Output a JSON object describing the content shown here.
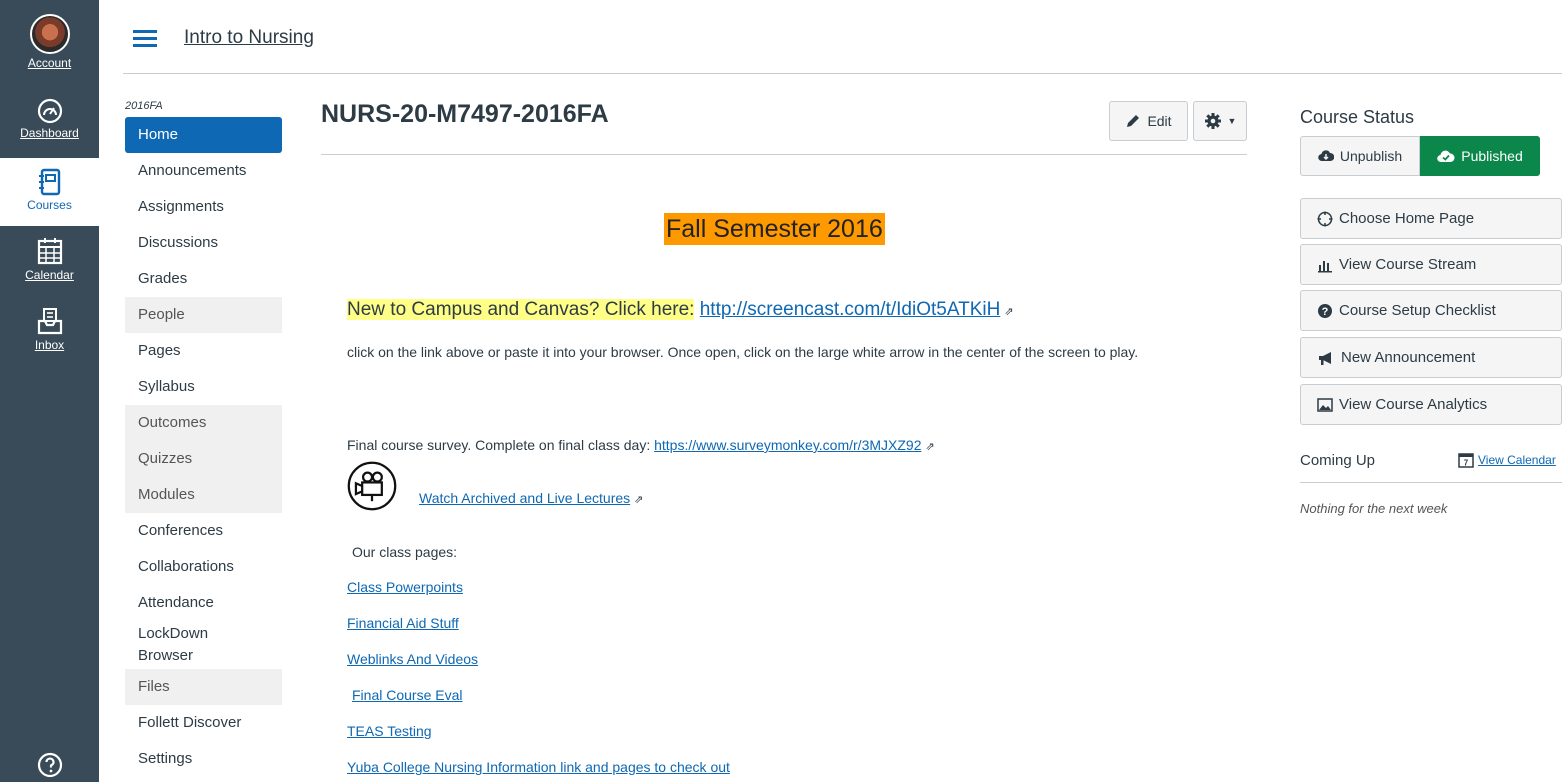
{
  "global_nav": {
    "account": "Account",
    "dashboard": "Dashboard",
    "courses": "Courses",
    "calendar": "Calendar",
    "inbox": "Inbox"
  },
  "header": {
    "course_name": "Intro to Nursing"
  },
  "course_nav": {
    "term": "2016FA",
    "items": [
      {
        "label": "Home"
      },
      {
        "label": "Announcements"
      },
      {
        "label": "Assignments"
      },
      {
        "label": "Discussions"
      },
      {
        "label": "Grades"
      },
      {
        "label": "People"
      },
      {
        "label": "Pages"
      },
      {
        "label": "Syllabus"
      },
      {
        "label": "Outcomes"
      },
      {
        "label": "Quizzes"
      },
      {
        "label": "Modules"
      },
      {
        "label": "Conferences"
      },
      {
        "label": "Collaborations"
      },
      {
        "label": "Attendance"
      },
      {
        "label": "LockDown Browser"
      },
      {
        "label": "Files"
      },
      {
        "label": "Follett Discover"
      },
      {
        "label": "Settings"
      }
    ]
  },
  "main": {
    "title": "NURS-20-M7497-2016FA",
    "edit_label": "Edit",
    "semester_banner": "Fall Semester 2016",
    "new_campus_text": "New to Campus and Canvas?  Click here:",
    "new_campus_link": "http://screencast.com/t/IdiOt5ATKiH",
    "instructions": "click on the link above or paste it into your browser.  Once open, click on the large white arrow in the center of the screen to play.",
    "survey_text": "Final course survey.  Complete on final class day:",
    "survey_link": "https://www.surveymonkey.com/r/3MJXZ92",
    "lectures_link": "Watch Archived and Live Lectures",
    "class_pages_label": "Our class pages:",
    "links": [
      "Class Powerpoints",
      "Financial Aid Stuff",
      "Weblinks And Videos",
      "Final Course Eval",
      "TEAS Testing",
      "Yuba College Nursing Information link and pages to check out"
    ]
  },
  "sidebar": {
    "title": "Course Status",
    "unpublish": "Unpublish",
    "published": "Published",
    "buttons": [
      "Choose Home Page",
      "View Course Stream",
      "Course Setup Checklist",
      "New Announcement",
      "View Course Analytics"
    ],
    "coming_up": "Coming Up",
    "view_calendar": "View Calendar",
    "calendar_day": "7",
    "nothing": "Nothing for the next week"
  },
  "colors": {
    "nav_bg": "#394b58",
    "brand_blue": "#0e68b3",
    "published_green": "#0b874b",
    "semester_highlight": "#ff9900",
    "link_highlight": "#ffff88"
  }
}
